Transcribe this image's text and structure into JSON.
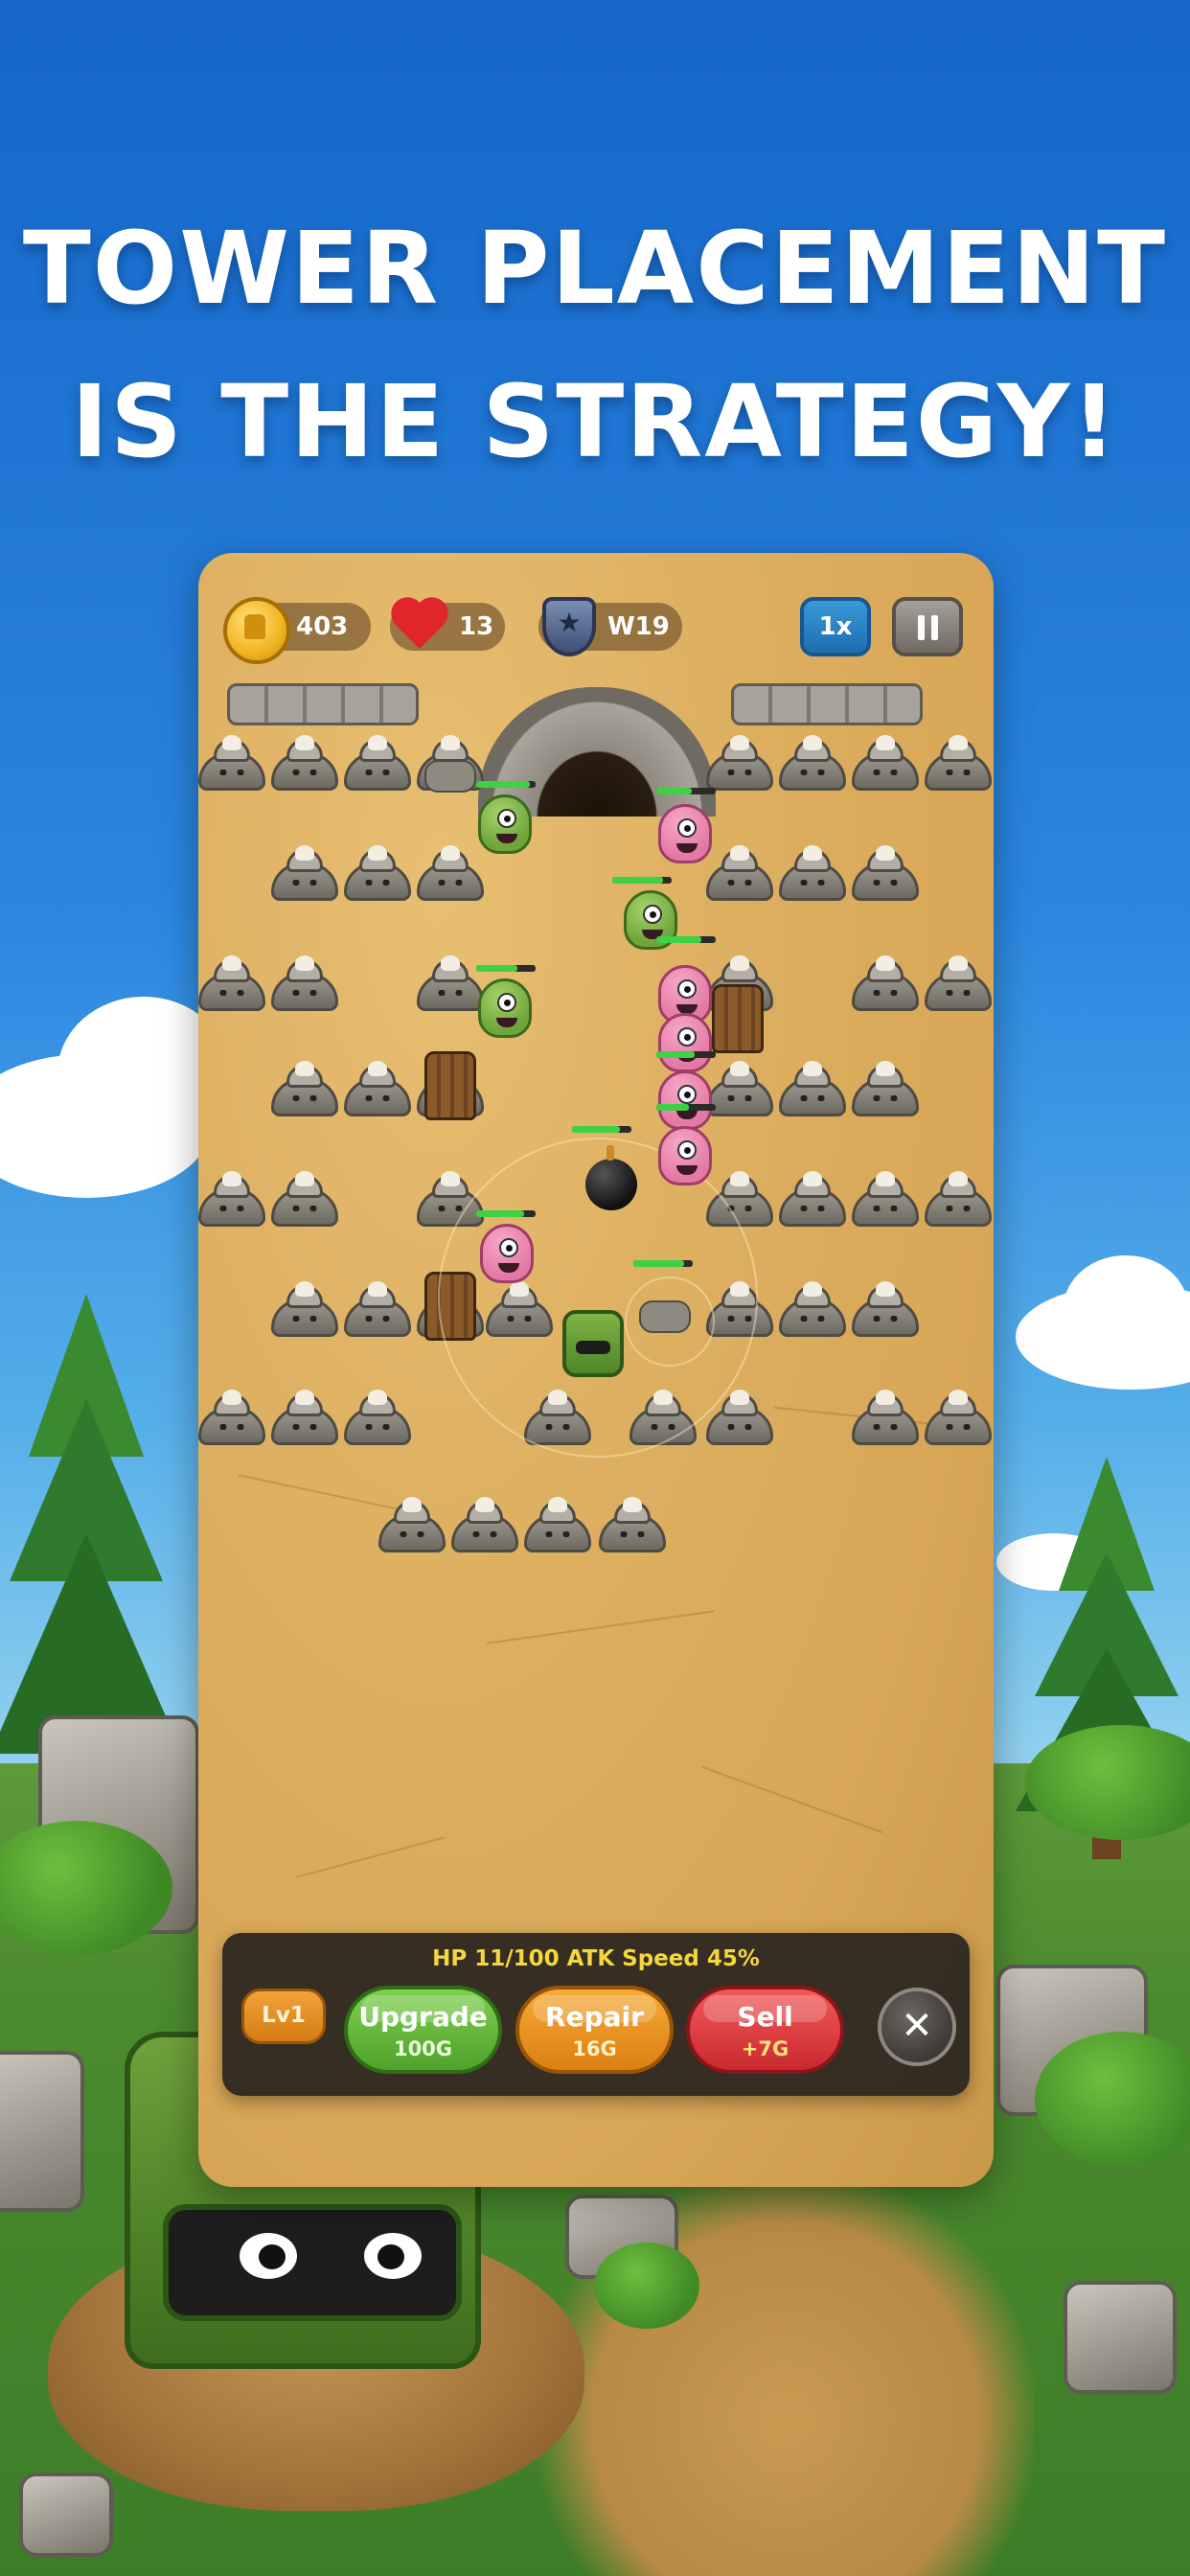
{
  "headline": {
    "line1": "TOWER PLACEMENT",
    "line2": "IS THE STRATEGY!"
  },
  "hud": {
    "gold": "403",
    "lives": "13",
    "wave": "W19",
    "speed_label": "1x",
    "icons": {
      "gold": "gold-coin-icon",
      "lives": "heart-icon",
      "wave": "shield-icon",
      "pause": "pause-icon"
    }
  },
  "panel": {
    "stats": "HP 11/100  ATK Speed 45%",
    "level": "Lv1",
    "upgrade": {
      "label": "Upgrade",
      "cost": "100G"
    },
    "repair": {
      "label": "Repair",
      "cost": "16G"
    },
    "sell": {
      "label": "Sell",
      "cost": "+7G"
    },
    "close_icon": "close-icon"
  },
  "colors": {
    "sky": "#2a86df",
    "sand": "#deb062",
    "stats_text": "#f5d63c",
    "upgrade_green": "#4fa22b",
    "repair_orange": "#dc7f12",
    "sell_red": "#c9292e"
  }
}
